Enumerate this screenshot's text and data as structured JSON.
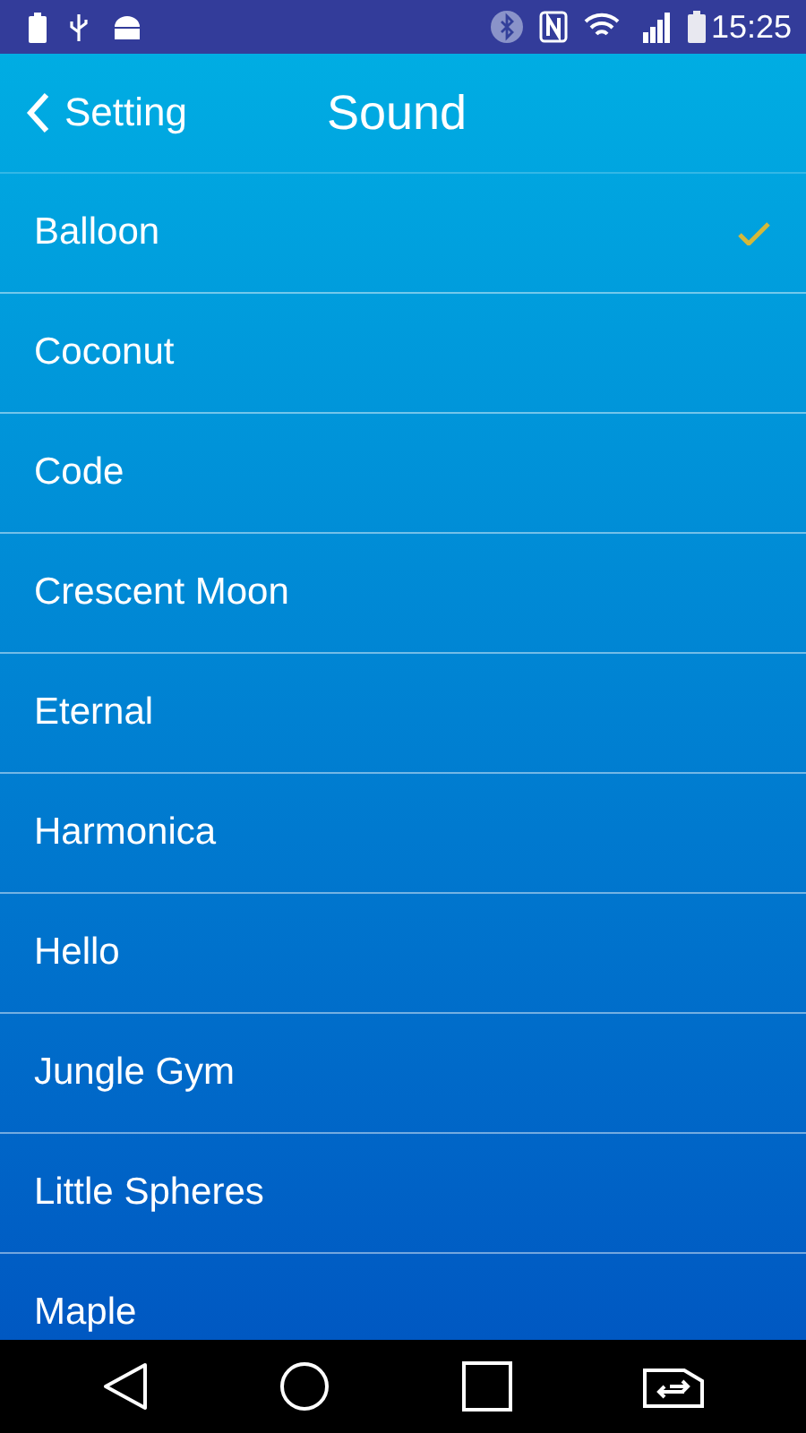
{
  "status_bar": {
    "time": "15:25"
  },
  "header": {
    "back_label": "Setting",
    "title": "Sound"
  },
  "sounds": [
    {
      "label": "Balloon",
      "selected": true
    },
    {
      "label": "Coconut",
      "selected": false
    },
    {
      "label": "Code",
      "selected": false
    },
    {
      "label": "Crescent Moon",
      "selected": false
    },
    {
      "label": "Eternal",
      "selected": false
    },
    {
      "label": "Harmonica",
      "selected": false
    },
    {
      "label": "Hello",
      "selected": false
    },
    {
      "label": "Jungle Gym",
      "selected": false
    },
    {
      "label": "Little Spheres",
      "selected": false
    },
    {
      "label": "Maple",
      "selected": false
    }
  ]
}
